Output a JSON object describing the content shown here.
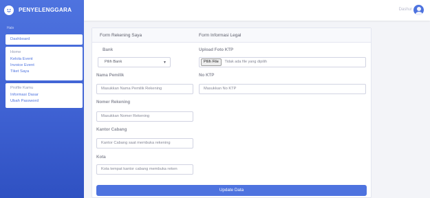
{
  "brand": {
    "name": "PENYELENGGARA"
  },
  "sidebar": {
    "heading": "Halo",
    "dashboard_label": "Dashboard",
    "event_group": [
      "Home",
      "Kelola Event",
      "Invoice Event",
      "Tiket Saya"
    ],
    "profile_group": [
      "Profile Kamu",
      "Informasi Dasar",
      "Ubah Password"
    ]
  },
  "topbar": {
    "user_name": "Dashur"
  },
  "form": {
    "section_left_title": "Form Rekening Saya",
    "section_right_title": "Form Informasi Legal",
    "bank": {
      "label": "Bank",
      "value": "Pilih Bank"
    },
    "owner": {
      "label": "Nama Pemilik",
      "placeholder": "Masukkan Nama Pemilik Rekening"
    },
    "account_number": {
      "label": "Nomer Rekening",
      "placeholder": "Masukkan Nomer Rekening"
    },
    "branch": {
      "label": "Kantor Cabang",
      "placeholder": "Kantor Cabang saat membuka rekening"
    },
    "city": {
      "label": "Kota",
      "placeholder": "Kota tempat kantor cabang membuka reken"
    },
    "ktp_photo": {
      "label": "Upload Foto KTP",
      "button": "Pilih File",
      "status": "Tidak ada file yang dipilih"
    },
    "ktp_number": {
      "label": "No KTP",
      "placeholder": "Masukkan No KTP"
    },
    "submit_label": "Update Data"
  },
  "colors": {
    "primary": "#4e73df",
    "sidebar_dark": "#2f51c2"
  },
  "icons": {
    "brand": "smile-icon",
    "avatar": "user-avatar-icon",
    "select": "caret-down-icon"
  }
}
